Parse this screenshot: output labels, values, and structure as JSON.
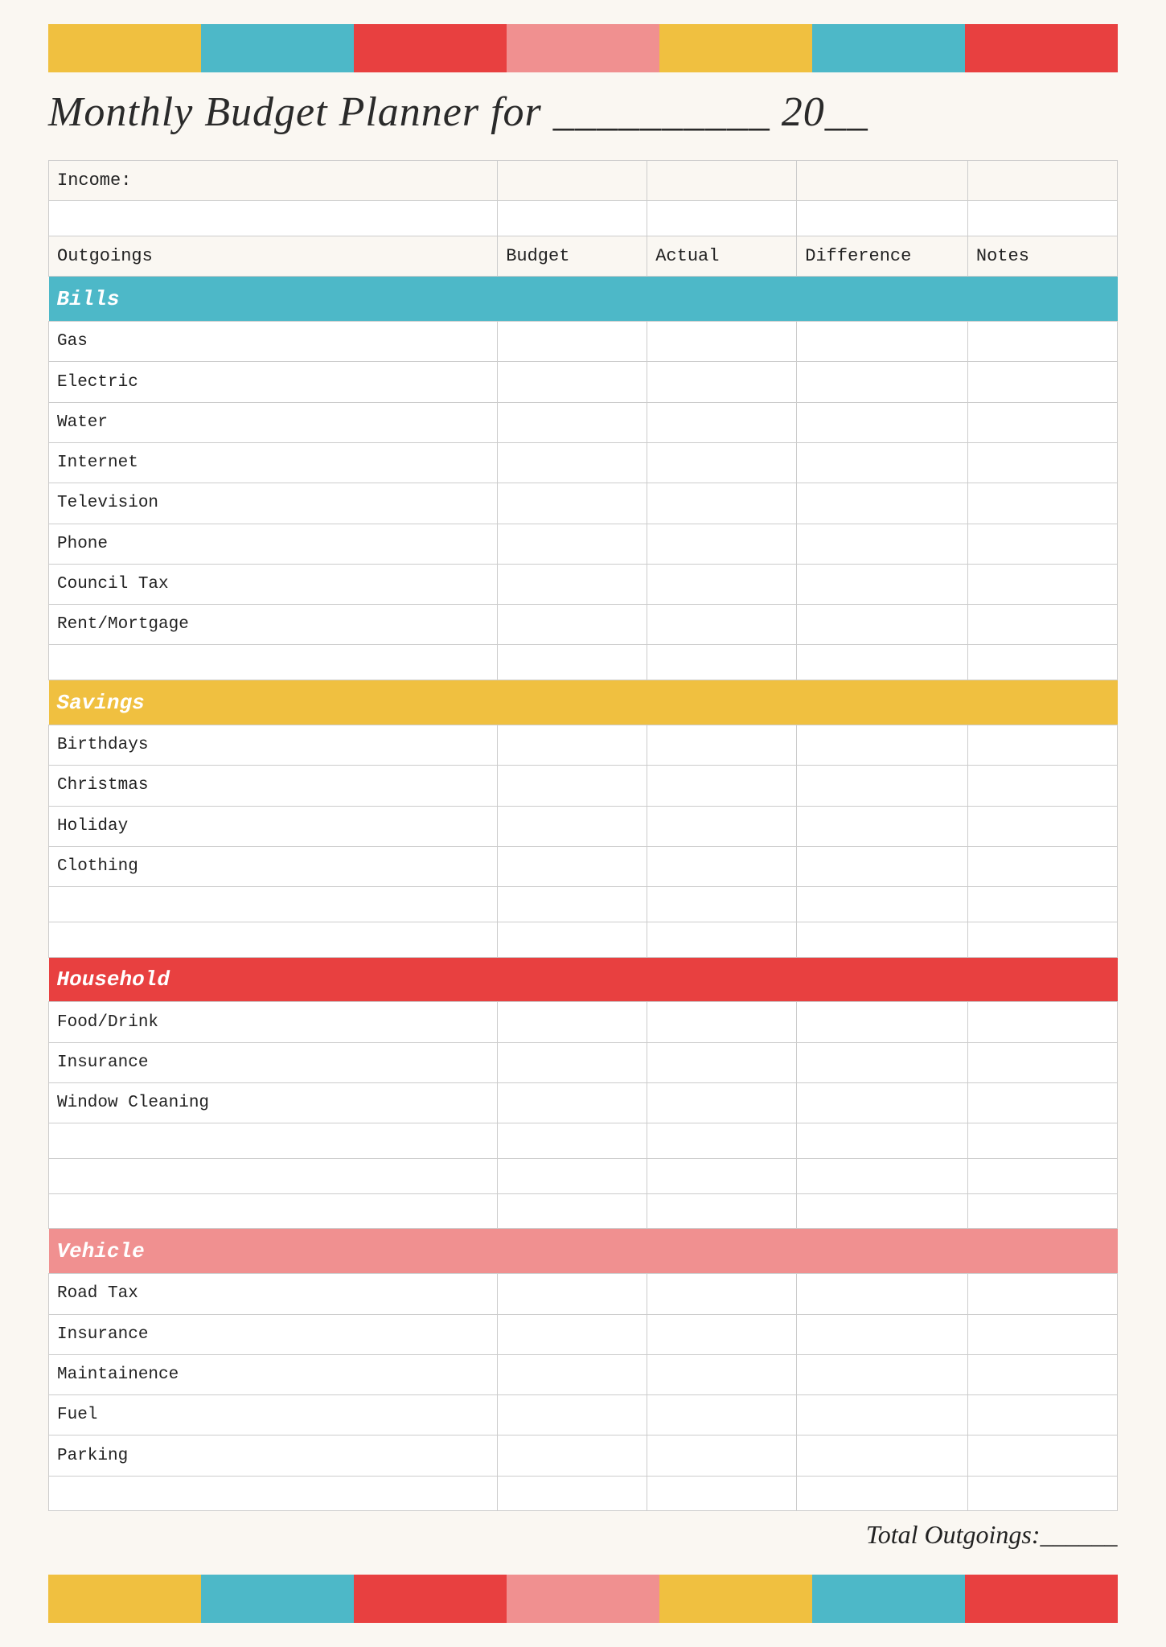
{
  "colorBars": {
    "top": [
      "yellow",
      "teal",
      "red",
      "pink",
      "yellow",
      "teal",
      "red"
    ],
    "bottom": [
      "yellow",
      "teal",
      "red",
      "pink",
      "yellow",
      "teal",
      "red"
    ]
  },
  "title": "Monthly Budget Planner for __________ 20__",
  "table": {
    "income_label": "Income:",
    "columns": {
      "outgoings": "Outgoings",
      "budget": "Budget",
      "actual": "Actual",
      "difference": "Difference",
      "notes": "Notes"
    },
    "categories": [
      {
        "name": "Bills",
        "color": "teal",
        "items": [
          "Gas",
          "Electric",
          "Water",
          "Internet",
          "Television",
          "Phone",
          "Council Tax",
          "Rent/Mortgage"
        ],
        "extra_empty": 1
      },
      {
        "name": "Savings",
        "color": "yellow",
        "items": [
          "Birthdays",
          "Christmas",
          "Holiday",
          "Clothing"
        ],
        "extra_empty": 2
      },
      {
        "name": "Household",
        "color": "red",
        "items": [
          "Food/Drink",
          "Insurance",
          "Window Cleaning"
        ],
        "extra_empty": 3
      },
      {
        "name": "Vehicle",
        "color": "pink",
        "items": [
          "Road Tax",
          "Insurance",
          "Maintainence",
          "Fuel",
          "Parking"
        ],
        "extra_empty": 1
      }
    ],
    "total_label": "Total Outgoings:______"
  }
}
